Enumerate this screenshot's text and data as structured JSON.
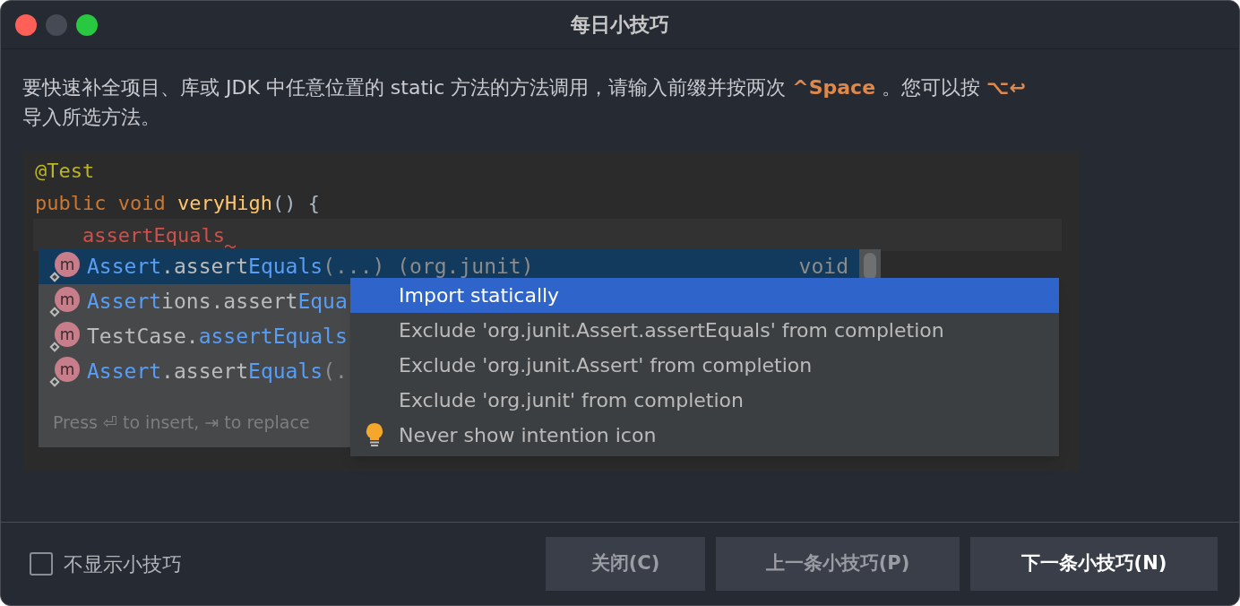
{
  "window": {
    "title": "每日小技巧"
  },
  "tip": [
    [
      {
        "text": "要快速补全项目、库或 JDK 中任意位置的 static 方法的方法调用，请输入前缀并按两次 ",
        "kind": "plain"
      },
      {
        "text": "^Space",
        "kind": "key"
      },
      {
        "text": " 。您可以按 ",
        "kind": "plain"
      },
      {
        "text": "⌥↩",
        "kind": "key"
      }
    ],
    [
      {
        "text": "导入所选方法。",
        "kind": "plain"
      }
    ]
  ],
  "code": {
    "lines": [
      {
        "indented": false,
        "segments": [
          {
            "text": "@Test",
            "kind": "annotation"
          }
        ]
      },
      {
        "indented": false,
        "segments": [
          {
            "text": "public void ",
            "kind": "keyword"
          },
          {
            "text": "veryHigh",
            "kind": "method"
          },
          {
            "text": "() {",
            "kind": "punct"
          }
        ]
      },
      {
        "indented": true,
        "segments": [
          {
            "text": "assertEquals",
            "kind": "error"
          }
        ]
      }
    ],
    "completion": {
      "items": [
        {
          "selected": true,
          "icon_letter": "m",
          "segments": [
            {
              "text": "Assert",
              "kind": "match"
            },
            {
              "text": ".assert",
              "kind": "plain"
            },
            {
              "text": "Equals",
              "kind": "match"
            },
            {
              "text": "(...) (org.junit)",
              "kind": "dim"
            }
          ],
          "type": "void"
        },
        {
          "selected": false,
          "icon_letter": "m",
          "segments": [
            {
              "text": "Assert",
              "kind": "match"
            },
            {
              "text": "ions.assert",
              "kind": "plain"
            },
            {
              "text": "Equa",
              "kind": "match"
            }
          ]
        },
        {
          "selected": false,
          "icon_letter": "m",
          "segments": [
            {
              "text": "TestCase.",
              "kind": "plain"
            },
            {
              "text": "assertEquals",
              "kind": "match"
            }
          ]
        },
        {
          "selected": false,
          "icon_letter": "m",
          "segments": [
            {
              "text": "Assert",
              "kind": "match"
            },
            {
              "text": ".assert",
              "kind": "plain"
            },
            {
              "text": "Equals",
              "kind": "match"
            },
            {
              "text": "(.",
              "kind": "dim"
            }
          ]
        }
      ],
      "hint": "Press ⏎ to insert, ⇥ to replace"
    },
    "intentions": [
      {
        "label": "Import statically",
        "selected": true,
        "bulb": false
      },
      {
        "label": "Exclude 'org.junit.Assert.assertEquals' from completion",
        "selected": false,
        "bulb": false
      },
      {
        "label": "Exclude 'org.junit.Assert' from completion",
        "selected": false,
        "bulb": false
      },
      {
        "label": "Exclude 'org.junit' from completion",
        "selected": false,
        "bulb": false
      },
      {
        "label": "Never show intention icon",
        "selected": false,
        "bulb": true
      }
    ]
  },
  "dont_show": {
    "label": "不显示小技巧",
    "checked": false
  },
  "buttons": [
    {
      "label": "关闭(C)",
      "default": false
    },
    {
      "label": "上一条小技巧(P)",
      "default": false
    },
    {
      "label": "下一条小技巧(N)",
      "default": true
    }
  ]
}
